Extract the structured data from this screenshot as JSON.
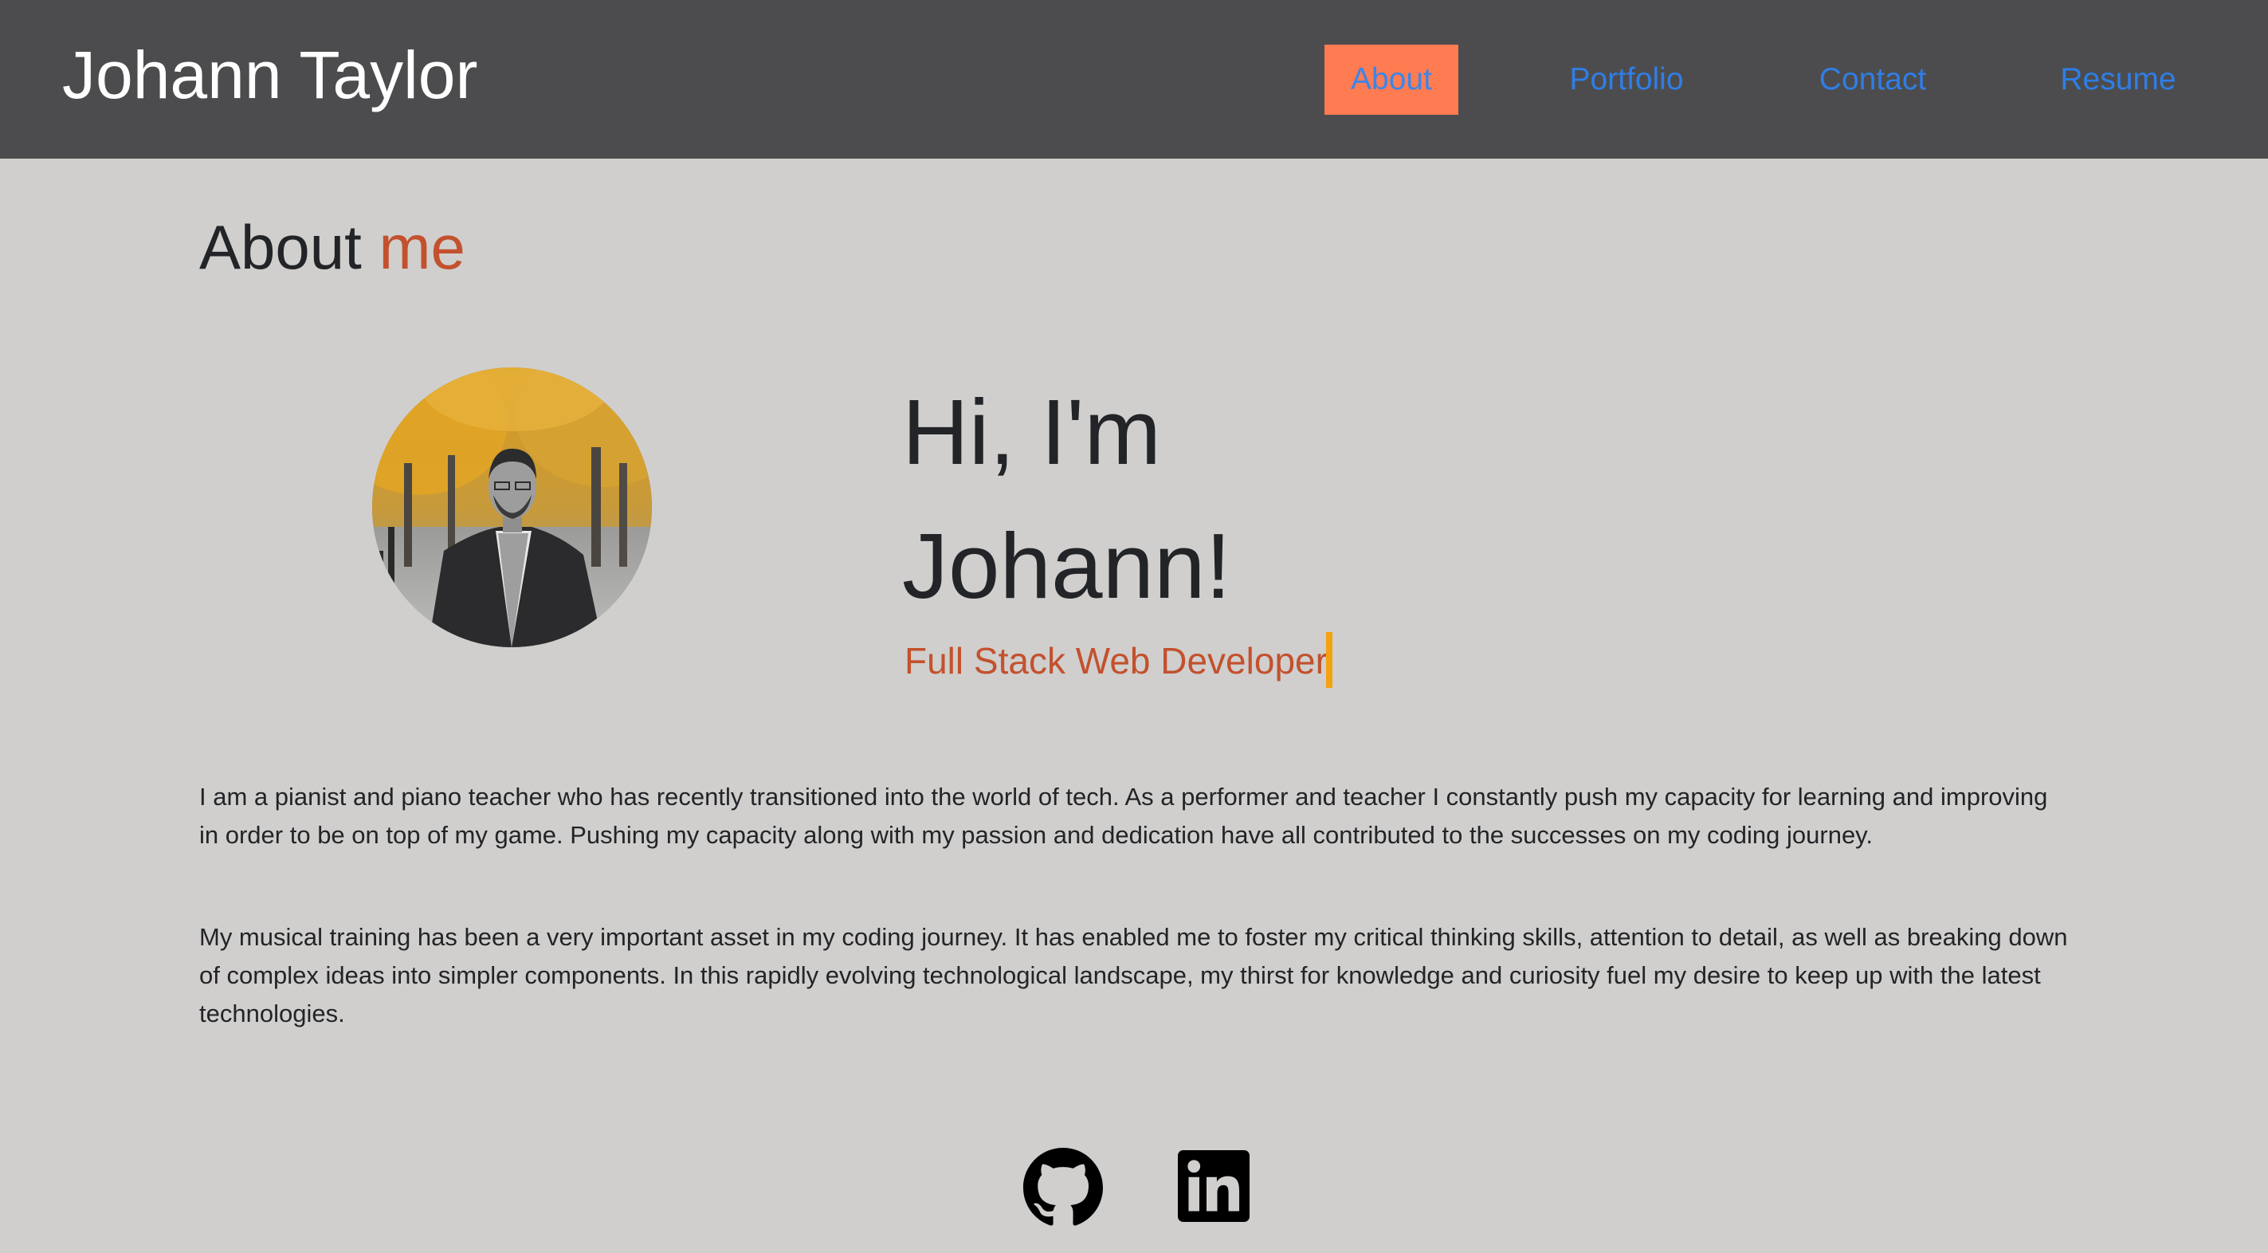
{
  "header": {
    "brand": "Johann Taylor",
    "nav": [
      {
        "label": "About",
        "active": true
      },
      {
        "label": "Portfolio",
        "active": false
      },
      {
        "label": "Contact",
        "active": false
      },
      {
        "label": "Resume",
        "active": false
      }
    ]
  },
  "about": {
    "heading_main": "About",
    "heading_accent": "me",
    "greeting_line1": "Hi, I'm",
    "greeting_line2": "Johann!",
    "subtitle": "Full Stack Web Developer",
    "paragraphs": [
      "I am a pianist and piano teacher who has recently transitioned into the world of tech. As a performer and teacher I constantly push my capacity for learning and improving in order to be on top of my game. Pushing my capacity along with my passion and dedication have all contributed to the successes on my coding journey.",
      "My musical training has been a very important asset in my coding journey. It has enabled me to foster my critical thinking skills, attention to detail, as well as breaking down of complex ideas into simpler components. In this rapidly evolving technological landscape, my thirst for knowledge and curiosity fuel my desire to keep up with the latest technologies."
    ]
  },
  "social": [
    {
      "icon": "github-icon"
    },
    {
      "icon": "linkedin-icon"
    }
  ],
  "colors": {
    "header_bg": "#4c4c4e",
    "page_bg": "#d0cfcd",
    "active_nav_bg": "#ff7b52",
    "link": "#2f7ee6",
    "accent": "#c3512e",
    "cursor": "#f3a20f"
  }
}
